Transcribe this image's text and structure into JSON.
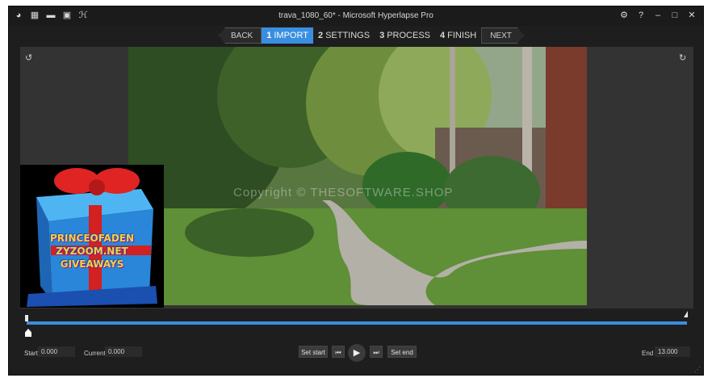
{
  "window": {
    "title": "trava_1080_60* - Microsoft Hyperlapse Pro"
  },
  "toolbar": {
    "left_icons": [
      "app-logo-icon",
      "new-project-icon",
      "open-folder-icon",
      "save-icon",
      "export-icon"
    ],
    "right_icons": [
      "settings-icon",
      "help-icon",
      "minimize-icon",
      "maximize-icon",
      "close-icon"
    ]
  },
  "wizard": {
    "back_label": "BACK",
    "next_label": "NEXT",
    "steps": [
      {
        "num": "1",
        "label": "IMPORT",
        "active": true
      },
      {
        "num": "2",
        "label": "SETTINGS",
        "active": false
      },
      {
        "num": "3",
        "label": "PROCESS",
        "active": false
      },
      {
        "num": "4",
        "label": "FINISH",
        "active": false
      }
    ]
  },
  "preview": {
    "watermark": "Copyright © THESOFTWARE.SHOP",
    "overlay_lines": [
      "PRINCEOFADEN",
      "ZYZOOM.NET",
      "GIVEAWAYS"
    ]
  },
  "timeline": {
    "position": 0.0
  },
  "controls": {
    "start_label": "Start",
    "start_value": "0.000",
    "current_label": "Current",
    "current_value": "0.000",
    "set_start_label": "Set start",
    "set_end_label": "Set end",
    "end_label": "End",
    "end_value": "13.000"
  },
  "colors": {
    "accent": "#3a8ee0",
    "background": "#1e1e1e",
    "panel": "#333333"
  }
}
